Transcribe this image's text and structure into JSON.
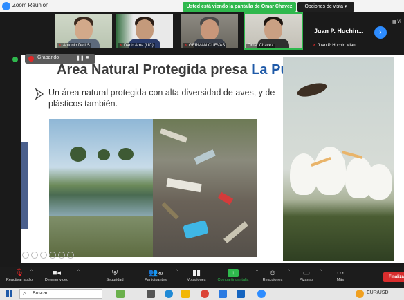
{
  "window": {
    "title": "Zoom Reunión",
    "share_banner": "Usted está viendo la pantalla de Omar Chavez",
    "view_options": "Opciones de vista"
  },
  "participants": [
    {
      "name": "Antonio De LS"
    },
    {
      "name": "Darío Ama (UC)"
    },
    {
      "name": "GERMAN CUEVAS"
    },
    {
      "name": "Omar Chavez"
    }
  ],
  "big_tile": {
    "title": "Juan P. Huchin...",
    "name": "Juan P. Huchin Mian"
  },
  "view_ctrl_label": "Vi",
  "recording": {
    "label": "Grabando"
  },
  "slide": {
    "title_main": "Área Natural Protegida presa ",
    "title_accent": "La Purísima",
    "bullet": "Un área natural protegida con alta diversidad de aves, y de plásticos también."
  },
  "toolbar": {
    "items": [
      {
        "label": "Reactivar audio",
        "icon": "mic-muted-icon"
      },
      {
        "label": "Detener video",
        "icon": "video-icon"
      },
      {
        "label": "Seguridad",
        "icon": "shield-icon"
      },
      {
        "label": "Participantes",
        "icon": "people-icon",
        "count": "49"
      },
      {
        "label": "Votaciones",
        "icon": "poll-icon"
      },
      {
        "label": "Compartir pantalla",
        "icon": "share-screen-icon"
      },
      {
        "label": "Reacciones",
        "icon": "reactions-icon"
      },
      {
        "label": "Pizarras",
        "icon": "whiteboard-icon"
      },
      {
        "label": "Más",
        "icon": "more-icon"
      }
    ],
    "finalize": "Finalizar"
  },
  "taskbar": {
    "search_placeholder": "Buscar",
    "currency": "EUR/USD"
  },
  "colors": {
    "accent_blue": "#1f5aa8",
    "share_green": "#2fb84d",
    "end_red": "#d92d2d"
  }
}
